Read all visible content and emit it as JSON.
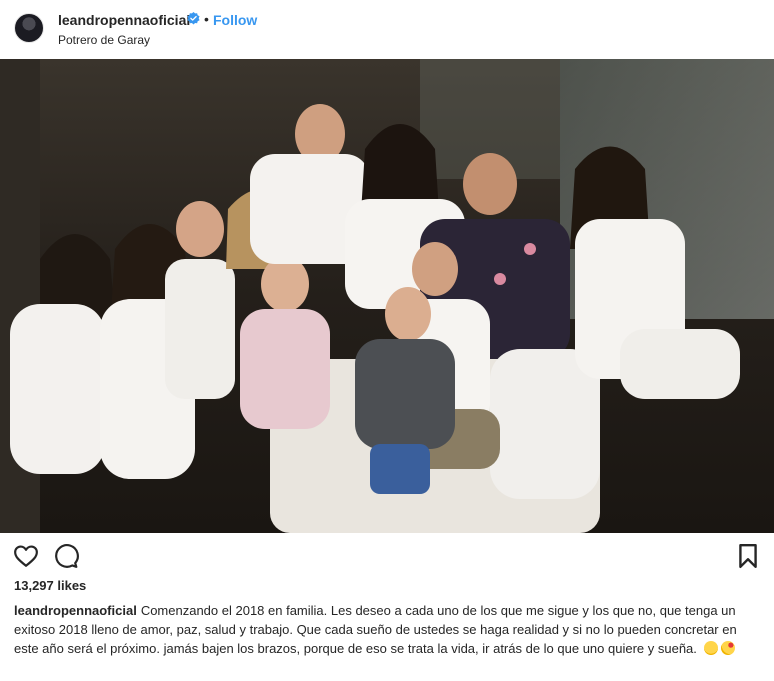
{
  "post": {
    "username": "leandropennaoficial",
    "verified_icon": "verified-badge-icon",
    "separator": "•",
    "follow_label": "Follow",
    "location": "Potrero de Garay"
  },
  "photo": {
    "description_icon": "group-photo"
  },
  "actions": {
    "like_icon": "heart-icon",
    "comment_icon": "comment-icon",
    "save_icon": "bookmark-icon"
  },
  "likes": "13,297 likes",
  "caption": {
    "username": "leandropennaoficial",
    "text": "Comenzando el 2018 en familia. Les deseo a cada uno de los que me sigue y los que no, que tenga un exitoso 2018 lleno de amor, paz, salud y trabajo. Que cada sueño de ustedes se haga realidad y si no lo pueden concretar en este año será el próximo. jamás bajen los brazos, porque de eso se trata la vida, ir atrás de lo que uno quiere y sueña.",
    "emojis": [
      "smiling-face-emoji",
      "kissing-face-emoji"
    ]
  },
  "colors": {
    "link": "#3897f0",
    "text": "#262626",
    "verified": "#3897f0"
  }
}
